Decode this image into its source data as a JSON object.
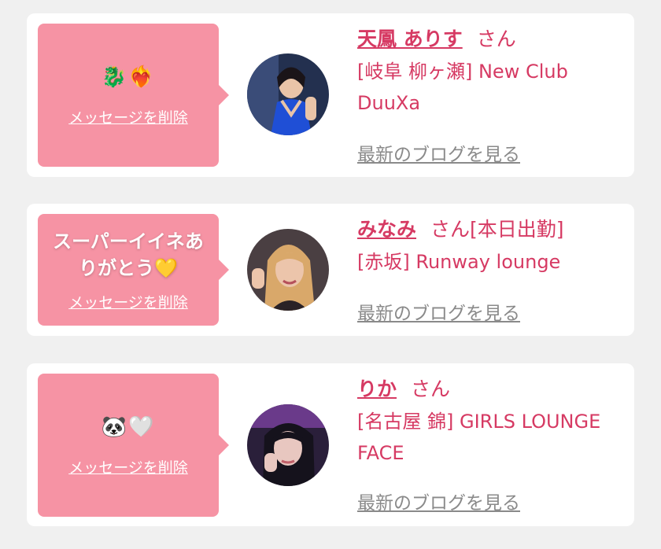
{
  "cards": [
    {
      "message": "🐉❤️‍🔥",
      "delete_label": "メッセージを削除",
      "name": "天鳳 ありす",
      "honorific": "さん",
      "tag": "",
      "shop": "[岐阜 柳ヶ瀬] New Club DuuXa",
      "blog_label": "最新のブログを見る",
      "avatar_icon": "cast-photo-icon",
      "avatar_colors": [
        "#2a3a6e",
        "#1f4fd6",
        "#e9c4a8"
      ]
    },
    {
      "message": "スーパーイイネありがとう💛",
      "delete_label": "メッセージを削除",
      "name": "みなみ",
      "honorific": "さん",
      "tag": "[本日出勤]",
      "shop": "[赤坂] Runway lounge",
      "blog_label": "最新のブログを見る",
      "avatar_icon": "cast-photo-icon",
      "avatar_colors": [
        "#5a4a4a",
        "#e0b89a",
        "#d9a86a"
      ]
    },
    {
      "message": "🐼🤍",
      "delete_label": "メッセージを削除",
      "name": "りか",
      "honorific": "さん",
      "tag": "",
      "shop": "[名古屋 錦] GIRLS LOUNGE FACE",
      "blog_label": "最新のブログを見る",
      "avatar_icon": "cast-photo-icon",
      "avatar_colors": [
        "#2a1f3a",
        "#7a3a8a",
        "#e8c7c0"
      ]
    }
  ],
  "colors": {
    "bubble": "#f693a4",
    "accent": "#d63a63",
    "muted": "#8a8a8a",
    "background": "#f0f0f0"
  }
}
